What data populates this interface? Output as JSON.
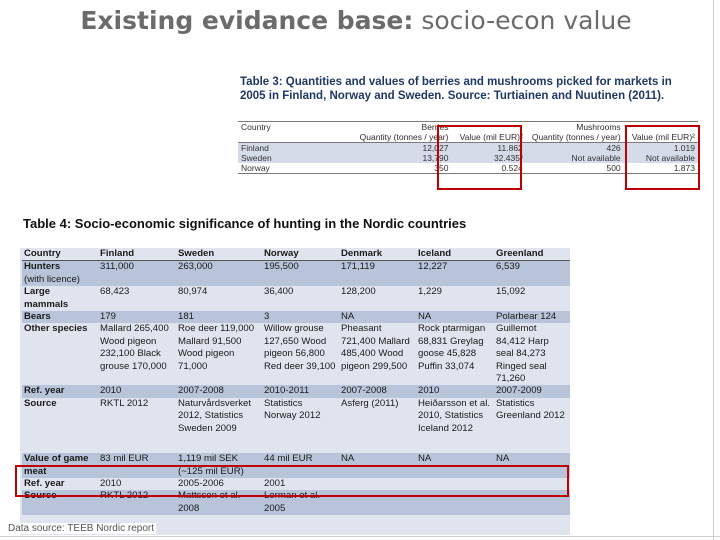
{
  "title": {
    "bold": "Existing evidance base:",
    "rest": " socio-econ value"
  },
  "table3": {
    "caption": "Table 3: Quantities and values of berries and mushrooms picked for markets in 2005 in Finland, Norway and Sweden. Source: Turtiainen and Nuutinen (2011).",
    "group_header": [
      "Country",
      "Berries",
      "",
      "Mushrooms",
      ""
    ],
    "sub_header": [
      "",
      "Quantity (tonnes / year)",
      "Value (mil EUR)²",
      "Quantity (tonnes / year)",
      "Value (mil EUR)²"
    ],
    "rows": [
      [
        "Finland",
        "12,027",
        "11.862",
        "426",
        "1.019"
      ],
      [
        "Sweden",
        "13,790",
        "32.435³",
        "Not available",
        "Not available"
      ],
      [
        "Norway",
        "350",
        "0.524",
        "500",
        "1.873"
      ]
    ]
  },
  "table4": {
    "caption": "Table 4: Socio-economic significance of hunting in the Nordic countries",
    "headers": [
      "Country",
      "Finland",
      "Sweden",
      "Norway",
      "Denmark",
      "Iceland",
      "Greenland"
    ],
    "rows": [
      {
        "label": "Hunters",
        "sublabel": "(with licence)",
        "cells": [
          "311,000",
          "263,000",
          "195,500",
          "171,119",
          "12,227",
          "6,539"
        ]
      },
      {
        "label": "Large mammals",
        "sublabel": "",
        "cells": [
          "68,423",
          "80,974",
          "36,400",
          "128,200",
          "1,229",
          "15,092"
        ]
      },
      {
        "label": "Bears",
        "sublabel": "",
        "cells": [
          "179",
          "181",
          "3",
          "NA",
          "NA",
          "Polarbear 124"
        ]
      },
      {
        "label": "Other species",
        "sublabel": "",
        "cells": [
          "Mallard 265,400 Wood pigeon 232,100 Black grouse 170,000",
          "Roe deer 119,000 Mallard 91,500 Wood pigeon 71,000",
          "Willow grouse 127,650 Wood pigeon 56,800 Red deer 39,100",
          "Pheasant 721,400 Mallard 485,400 Wood pigeon 299,500",
          "Rock ptarmigan 68,831 Greylag goose 45,828 Puffin 33,074",
          "Guillemot 84,412 Harp seal 84,273 Ringed seal 71,260"
        ]
      },
      {
        "label": "Ref. year",
        "sublabel": "",
        "cells": [
          "2010",
          "2007-2008",
          "2010-2011",
          "2007-2008",
          "2010",
          "2007-2009"
        ]
      },
      {
        "label": "Source",
        "sublabel": "",
        "cells": [
          "RKTL 2012",
          "Naturvårdsverket 2012, Statistics Sweden 2009",
          "Statistics Norway 2012",
          "Asferg (2011)",
          "Heiðarsson et al. 2010, Statistics Iceland 2012",
          "Statistics Greenland 2012"
        ]
      },
      {
        "label": "Value of game meat",
        "sublabel": "",
        "cells": [
          "83 mil EUR",
          "1,119 mil SEK (~125 mil EUR)",
          "44 mil EUR",
          "NA",
          "NA",
          "NA"
        ]
      },
      {
        "label": "Ref. year",
        "sublabel": "",
        "cells": [
          "2010",
          "2005-2006",
          "2001",
          "",
          "",
          ""
        ]
      },
      {
        "label": "Source",
        "sublabel": "",
        "cells": [
          "RKTL 2012",
          "Mattsson et al. 2008",
          "Lorman et al. 2005",
          "",
          "",
          ""
        ]
      }
    ]
  },
  "source_note": "Data source: TEEB Nordic report",
  "colors": {
    "highlight_box": "#c00000",
    "table3_band": "#d5dce9",
    "table4_background": "#dfe4ee",
    "table4_band": "#b8c4da",
    "title": "#6b6b6b"
  }
}
